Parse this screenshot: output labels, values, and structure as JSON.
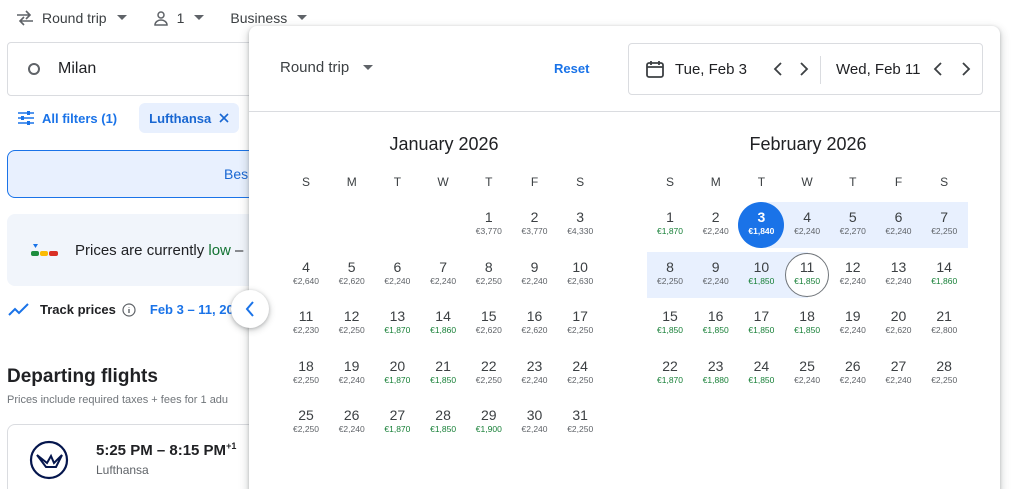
{
  "topbar": {
    "trip_type": "Round trip",
    "passengers": "1",
    "cabin": "Business"
  },
  "search": {
    "origin": "Milan"
  },
  "filters": {
    "all_filters_label": "All filters (1)",
    "chip_label": "Lufthansa"
  },
  "results": {
    "best_tab_label": "Bes",
    "price_insight_prefix": "Prices are currently ",
    "price_insight_level": "low",
    "price_insight_suffix": " –",
    "track_label": "Track prices",
    "track_dates": "Feb 3 – 11, 20",
    "departing_title": "Departing flights",
    "departing_note": "Prices include required taxes + fees for 1 adu",
    "flight_time": "5:25 PM – 8:15 PM",
    "flight_time_sup": "+1",
    "flight_airline": "Lufthansa"
  },
  "calendar": {
    "trip_type": "Round trip",
    "reset_label": "Reset",
    "depart_date": "Tue, Feb 3",
    "return_date": "Wed, Feb 11",
    "weekdays": [
      "S",
      "M",
      "T",
      "W",
      "T",
      "F",
      "S"
    ],
    "months": [
      {
        "title": "January 2026",
        "first_weekday": 4,
        "days": [
          {
            "d": "1",
            "p": "€3,770",
            "g": false
          },
          {
            "d": "2",
            "p": "€3,770",
            "g": false
          },
          {
            "d": "3",
            "p": "€4,330",
            "g": false
          },
          {
            "d": "4",
            "p": "€2,640",
            "g": false
          },
          {
            "d": "5",
            "p": "€2,620",
            "g": false
          },
          {
            "d": "6",
            "p": "€2,240",
            "g": false
          },
          {
            "d": "7",
            "p": "€2,240",
            "g": false
          },
          {
            "d": "8",
            "p": "€2,250",
            "g": false
          },
          {
            "d": "9",
            "p": "€2,240",
            "g": false
          },
          {
            "d": "10",
            "p": "€2,630",
            "g": false
          },
          {
            "d": "11",
            "p": "€2,230",
            "g": false
          },
          {
            "d": "12",
            "p": "€2,250",
            "g": false
          },
          {
            "d": "13",
            "p": "€1,870",
            "g": true
          },
          {
            "d": "14",
            "p": "€1,860",
            "g": true
          },
          {
            "d": "15",
            "p": "€2,620",
            "g": false
          },
          {
            "d": "16",
            "p": "€2,620",
            "g": false
          },
          {
            "d": "17",
            "p": "€2,250",
            "g": false
          },
          {
            "d": "18",
            "p": "€2,250",
            "g": false
          },
          {
            "d": "19",
            "p": "€2,240",
            "g": false
          },
          {
            "d": "20",
            "p": "€1,870",
            "g": true
          },
          {
            "d": "21",
            "p": "€1,850",
            "g": true
          },
          {
            "d": "22",
            "p": "€2,250",
            "g": false
          },
          {
            "d": "23",
            "p": "€2,240",
            "g": false
          },
          {
            "d": "24",
            "p": "€2,250",
            "g": false
          },
          {
            "d": "25",
            "p": "€2,250",
            "g": false
          },
          {
            "d": "26",
            "p": "€2,240",
            "g": false
          },
          {
            "d": "27",
            "p": "€1,870",
            "g": true
          },
          {
            "d": "28",
            "p": "€1,850",
            "g": true
          },
          {
            "d": "29",
            "p": "€1,900",
            "g": true
          },
          {
            "d": "30",
            "p": "€2,240",
            "g": false
          },
          {
            "d": "31",
            "p": "€2,250",
            "g": false
          }
        ]
      },
      {
        "title": "February 2026",
        "first_weekday": 0,
        "days": [
          {
            "d": "1",
            "p": "€1,870",
            "g": true
          },
          {
            "d": "2",
            "p": "€2,240",
            "g": false
          },
          {
            "d": "3",
            "p": "€1,840",
            "g": true,
            "sel": "start"
          },
          {
            "d": "4",
            "p": "€2,240",
            "g": false
          },
          {
            "d": "5",
            "p": "€2,270",
            "g": false
          },
          {
            "d": "6",
            "p": "€2,240",
            "g": false
          },
          {
            "d": "7",
            "p": "€2,250",
            "g": false
          },
          {
            "d": "8",
            "p": "€2,250",
            "g": false
          },
          {
            "d": "9",
            "p": "€2,240",
            "g": false
          },
          {
            "d": "10",
            "p": "€1,850",
            "g": true
          },
          {
            "d": "11",
            "p": "€1,850",
            "g": true,
            "sel": "end"
          },
          {
            "d": "12",
            "p": "€2,240",
            "g": false
          },
          {
            "d": "13",
            "p": "€2,240",
            "g": false
          },
          {
            "d": "14",
            "p": "€1,860",
            "g": true
          },
          {
            "d": "15",
            "p": "€1,850",
            "g": true
          },
          {
            "d": "16",
            "p": "€1,850",
            "g": true
          },
          {
            "d": "17",
            "p": "€1,850",
            "g": true
          },
          {
            "d": "18",
            "p": "€1,850",
            "g": true
          },
          {
            "d": "19",
            "p": "€2,240",
            "g": false
          },
          {
            "d": "20",
            "p": "€2,620",
            "g": false
          },
          {
            "d": "21",
            "p": "€2,800",
            "g": false
          },
          {
            "d": "22",
            "p": "€1,870",
            "g": true
          },
          {
            "d": "23",
            "p": "€1,880",
            "g": true
          },
          {
            "d": "24",
            "p": "€1,850",
            "g": true
          },
          {
            "d": "25",
            "p": "€2,240",
            "g": false
          },
          {
            "d": "26",
            "p": "€2,240",
            "g": false
          },
          {
            "d": "27",
            "p": "€2,240",
            "g": false
          },
          {
            "d": "28",
            "p": "€2,250",
            "g": false
          }
        ]
      }
    ]
  },
  "colors": {
    "accent": "#1a73e8",
    "range": "#e8f0fe",
    "low_price": "#188038"
  }
}
